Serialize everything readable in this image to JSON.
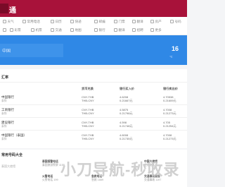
{
  "header": {
    "logo_text": "通"
  },
  "nav": {
    "items": [
      {
        "label": "天气",
        "icon": "weather-icon"
      },
      {
        "label": "常用电话",
        "icon": "phone-icon"
      },
      {
        "label": "日历",
        "icon": "calendar-icon"
      },
      {
        "label": "快递",
        "icon": "delivery-icon"
      },
      {
        "label": "邮编",
        "icon": "mail-icon"
      },
      {
        "label": "门票",
        "icon": "ticket-icon"
      },
      {
        "label": "翻译",
        "icon": "translate-icon"
      },
      {
        "label": "房产",
        "icon": "house-icon"
      },
      {
        "label": "号码",
        "icon": "number-icon"
      },
      {
        "label": "",
        "icon": "square-icon"
      },
      {
        "label": "彩票",
        "icon": "lottery-icon"
      },
      {
        "label": "机票",
        "icon": "flight-icon"
      },
      {
        "label": "交通",
        "icon": "traffic-icon"
      },
      {
        "label": "地图",
        "icon": "map-icon"
      },
      {
        "label": "银行",
        "icon": "bank-icon"
      },
      {
        "label": "翻译",
        "icon": "translate-icon"
      },
      {
        "label": "招聘",
        "icon": "job-icon"
      },
      {
        "label": "更多",
        "icon": "more-icon"
      }
    ]
  },
  "hero": {
    "input_placeholder": "中国",
    "number": "16",
    "sub": "℃"
  },
  "rates": {
    "title": "汇率",
    "headers": [
      "货币兑换",
      "银行买入价",
      "银行卖出价"
    ],
    "rows": [
      {
        "bank": "中国银行",
        "sub": "泰铢",
        "pair1": "CNY-THB",
        "pair2": "THB-CNY",
        "buy1": "4.6208",
        "buy2": "0.21667元",
        "sell1": "4.70538",
        "sell2": "0.21609元"
      },
      {
        "bank": "工商银行",
        "sub": "泰铢",
        "pair1": "CNY-THB",
        "pair2": "THB-CNY",
        "buy1": "4.5875",
        "buy2": "0.21798元",
        "sell1": "4.7008",
        "sell2": "0.21273元"
      },
      {
        "bank": "建设银行",
        "sub": "泰铢",
        "pair1": "CNY-THB",
        "pair2": "THB-CNY",
        "buy1": "4.598",
        "buy2": "0.21748元",
        "sell1": "4.705",
        "sell2": "0.21254元"
      },
      {
        "bank": "中国银行（泰国）",
        "sub": "泰铢",
        "pair1": "CNY-THB",
        "pair2": "THB-CNY",
        "buy1": "4.6008",
        "buy2": "0.21735元",
        "sell1": "4.7008",
        "sell2": "0.21273元"
      }
    ]
  },
  "phones": {
    "title": "常用号码大全",
    "side": "泰国大使馆",
    "cols": [
      {
        "head": "泰国报警电话",
        "line": "泰国旅游警察 1155"
      },
      {
        "head": "火警电话",
        "line": "火警电话 199"
      },
      {
        "head": "急救电话",
        "line": "急救 1669"
      },
      {
        "head": "中国大使馆",
        "line": "使馆电话"
      },
      {
        "head": "交通事故报告",
        "line": "交通事故 1197"
      }
    ]
  },
  "watermark": "小刀导航-秒收录"
}
